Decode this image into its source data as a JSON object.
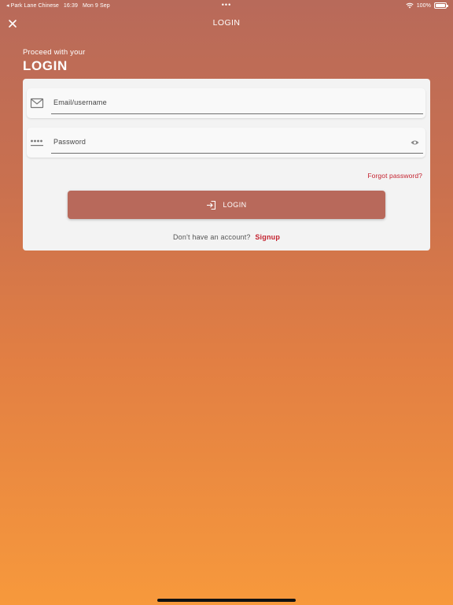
{
  "status_bar": {
    "back_app": "Park Lane Chinese",
    "time": "16:39",
    "date": "Mon 9 Sep",
    "dots": "•••",
    "battery": "100%"
  },
  "nav": {
    "title": "LOGIN",
    "close_icon": "close-icon"
  },
  "heading": {
    "subtitle": "Proceed with your",
    "title": "LOGIN"
  },
  "form": {
    "email_placeholder": "Email/username",
    "password_placeholder": "Password",
    "forgot_label": "Forgot password?",
    "login_label": "LOGIN",
    "signup_prompt": "Don't have an account?",
    "signup_label": "Signup"
  },
  "colors": {
    "accent": "#b8695b",
    "link": "#c4222f",
    "gradient_top": "#b86a5a",
    "gradient_bottom": "#f7993c"
  }
}
